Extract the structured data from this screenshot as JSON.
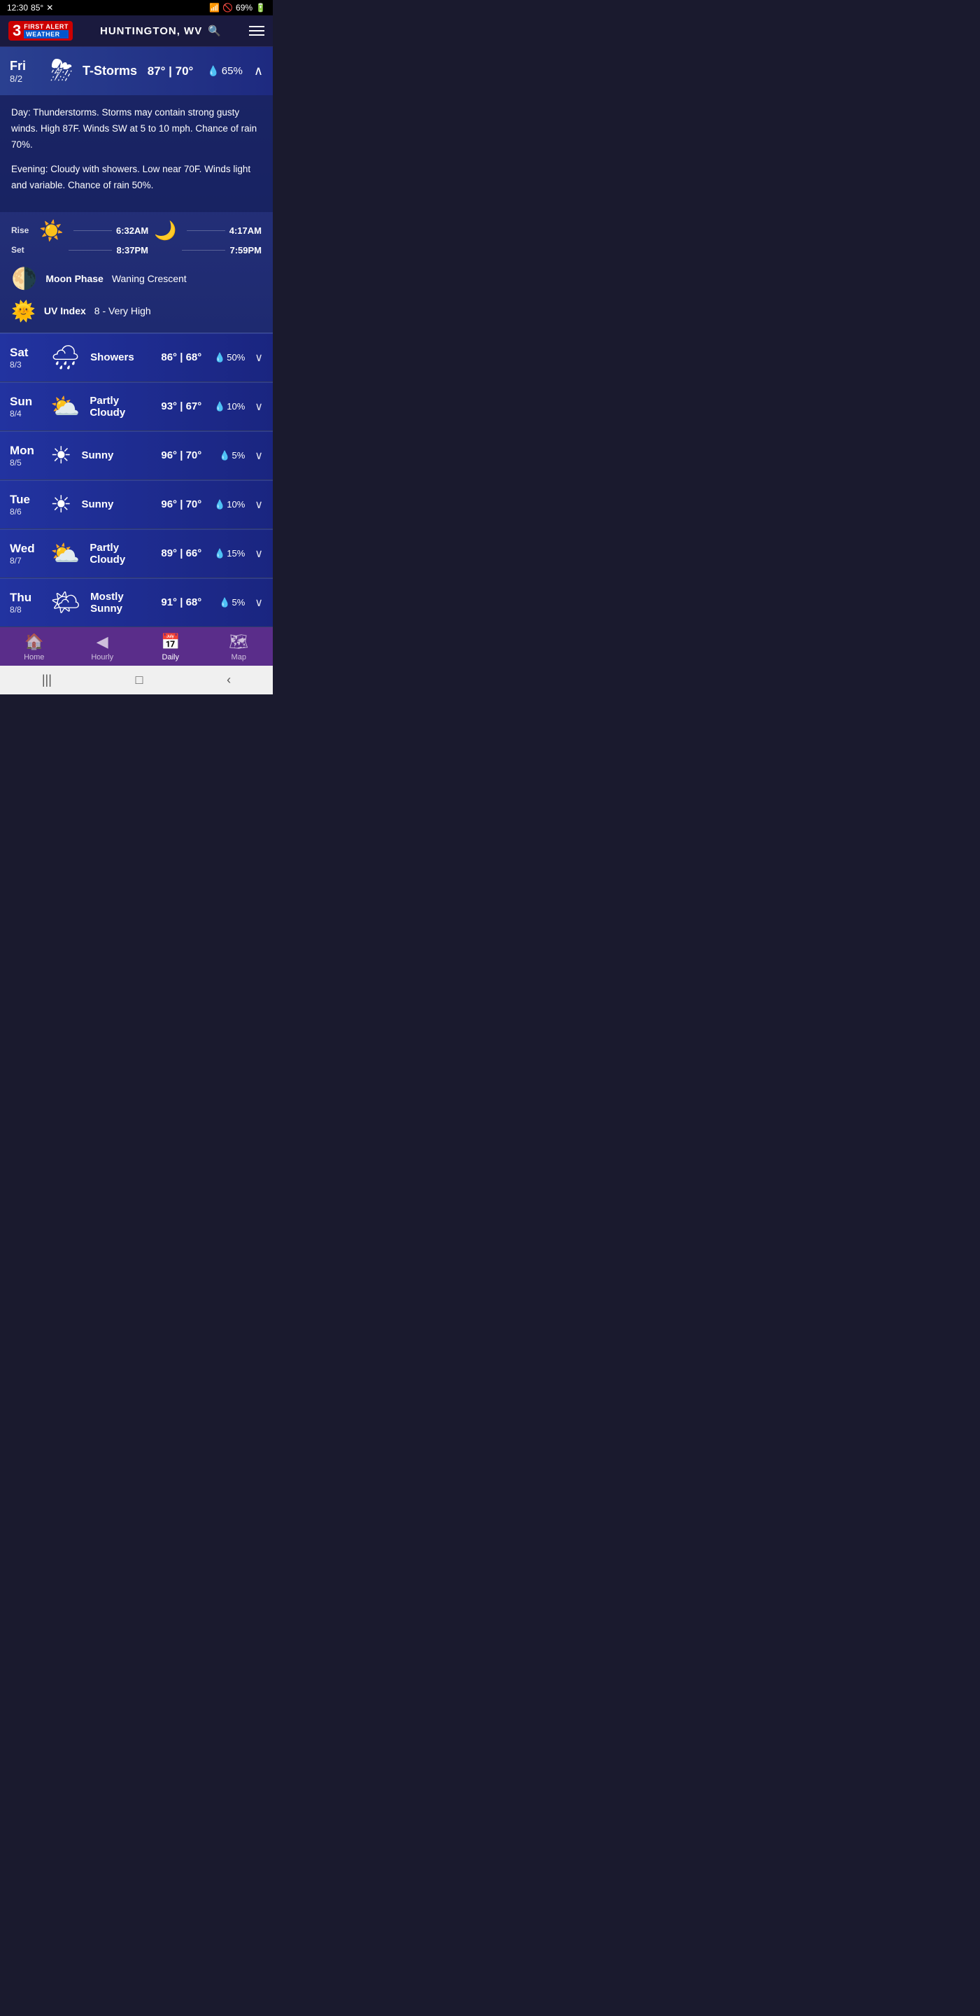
{
  "statusBar": {
    "time": "12:30",
    "temp": "85°",
    "closeIcon": "✕",
    "wifi": "wifi",
    "battery": "69%"
  },
  "header": {
    "logoNum": "3",
    "logoFirstAlert": "FIRST ALERT",
    "logoWeather": "WEATHER",
    "location": "HUNTINGTON, WV",
    "searchIcon": "🔍",
    "menuIcon": "☰"
  },
  "expandedForecast": {
    "dayName": "Fri",
    "date": "8/2",
    "icon": "⛈",
    "condition": "T-Storms",
    "highTemp": "87°",
    "lowTemp": "70°",
    "rainChance": "65%",
    "dayDetail": "Day: Thunderstorms. Storms may contain strong gusty winds. High 87F. Winds SW at 5 to 10 mph. Chance of rain 70%.",
    "eveningDetail": "Evening: Cloudy with showers. Low near 70F. Winds light and variable. Chance of rain 50%.",
    "sunRise": "6:32AM",
    "sunSet": "8:37PM",
    "moonRise": "4:17AM",
    "moonSet": "7:59PM",
    "moonPhase": "Waning Crescent",
    "uvIndex": "8 - Very High",
    "riseLabel": "Rise",
    "setLabel": "Set",
    "moonPhaseLabel": "Moon Phase",
    "uvIndexLabel": "UV Index"
  },
  "forecasts": [
    {
      "dayName": "Sat",
      "date": "8/3",
      "icon": "🌧",
      "condition": "Showers",
      "highTemp": "86°",
      "lowTemp": "68°",
      "rainChance": "50%"
    },
    {
      "dayName": "Sun",
      "date": "8/4",
      "icon": "⛅",
      "condition": "Partly\nCloudy",
      "highTemp": "93°",
      "lowTemp": "67°",
      "rainChance": "10%"
    },
    {
      "dayName": "Mon",
      "date": "8/5",
      "icon": "☀",
      "condition": "Sunny",
      "highTemp": "96°",
      "lowTemp": "70°",
      "rainChance": "5%"
    },
    {
      "dayName": "Tue",
      "date": "8/6",
      "icon": "☀",
      "condition": "Sunny",
      "highTemp": "96°",
      "lowTemp": "70°",
      "rainChance": "10%"
    },
    {
      "dayName": "Wed",
      "date": "8/7",
      "icon": "⛅",
      "condition": "Partly\nCloudy",
      "highTemp": "89°",
      "lowTemp": "66°",
      "rainChance": "15%"
    },
    {
      "dayName": "Thu",
      "date": "8/8",
      "icon": "🌤",
      "condition": "Mostly\nSunny",
      "highTemp": "91°",
      "lowTemp": "68°",
      "rainChance": "5%"
    }
  ],
  "bottomNav": {
    "items": [
      {
        "label": "Home",
        "icon": "🏠",
        "active": false
      },
      {
        "label": "Hourly",
        "icon": "◀",
        "active": false
      },
      {
        "label": "Daily",
        "icon": "📅",
        "active": true
      },
      {
        "label": "Map",
        "icon": "🗺",
        "active": false
      }
    ]
  },
  "androidNav": {
    "back": "‹",
    "home": "□",
    "recent": "|||"
  }
}
